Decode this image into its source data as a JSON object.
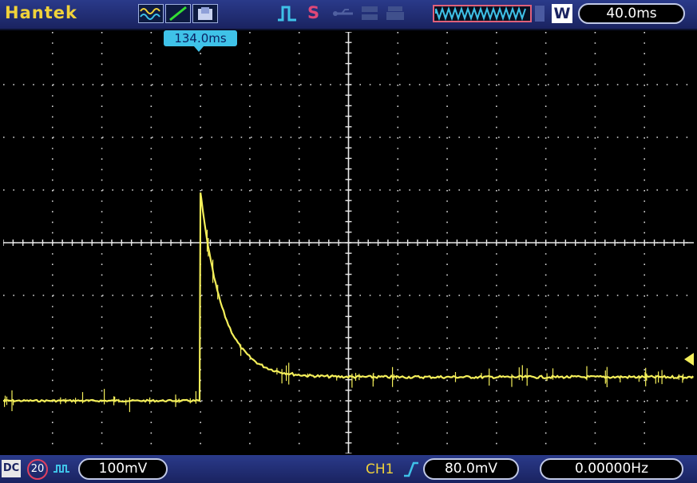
{
  "brand": "Hantek",
  "trigger_mode_symbol": "S",
  "timebase": {
    "mode_letter": "W",
    "value": "40.0ms"
  },
  "cursor": {
    "label": "134.0ms"
  },
  "bottom": {
    "coupling": "DC",
    "bw_limit": "20",
    "volts_per_div": "100mV",
    "channel": "CH1",
    "trigger_level": "80.0mV",
    "frequency": "0.00000Hz"
  },
  "colors": {
    "trace": "#f4ef5a",
    "grid": "#d9d9d9",
    "cursor": "#3fc2e8",
    "bar": "#1f2c72",
    "brand": "#f0d23a"
  },
  "trace": {
    "baseline_div": -3.0,
    "step_time_div": 4.0,
    "peak_div": 0.95,
    "settle_div": -2.55,
    "decay_div": 0.45
  }
}
